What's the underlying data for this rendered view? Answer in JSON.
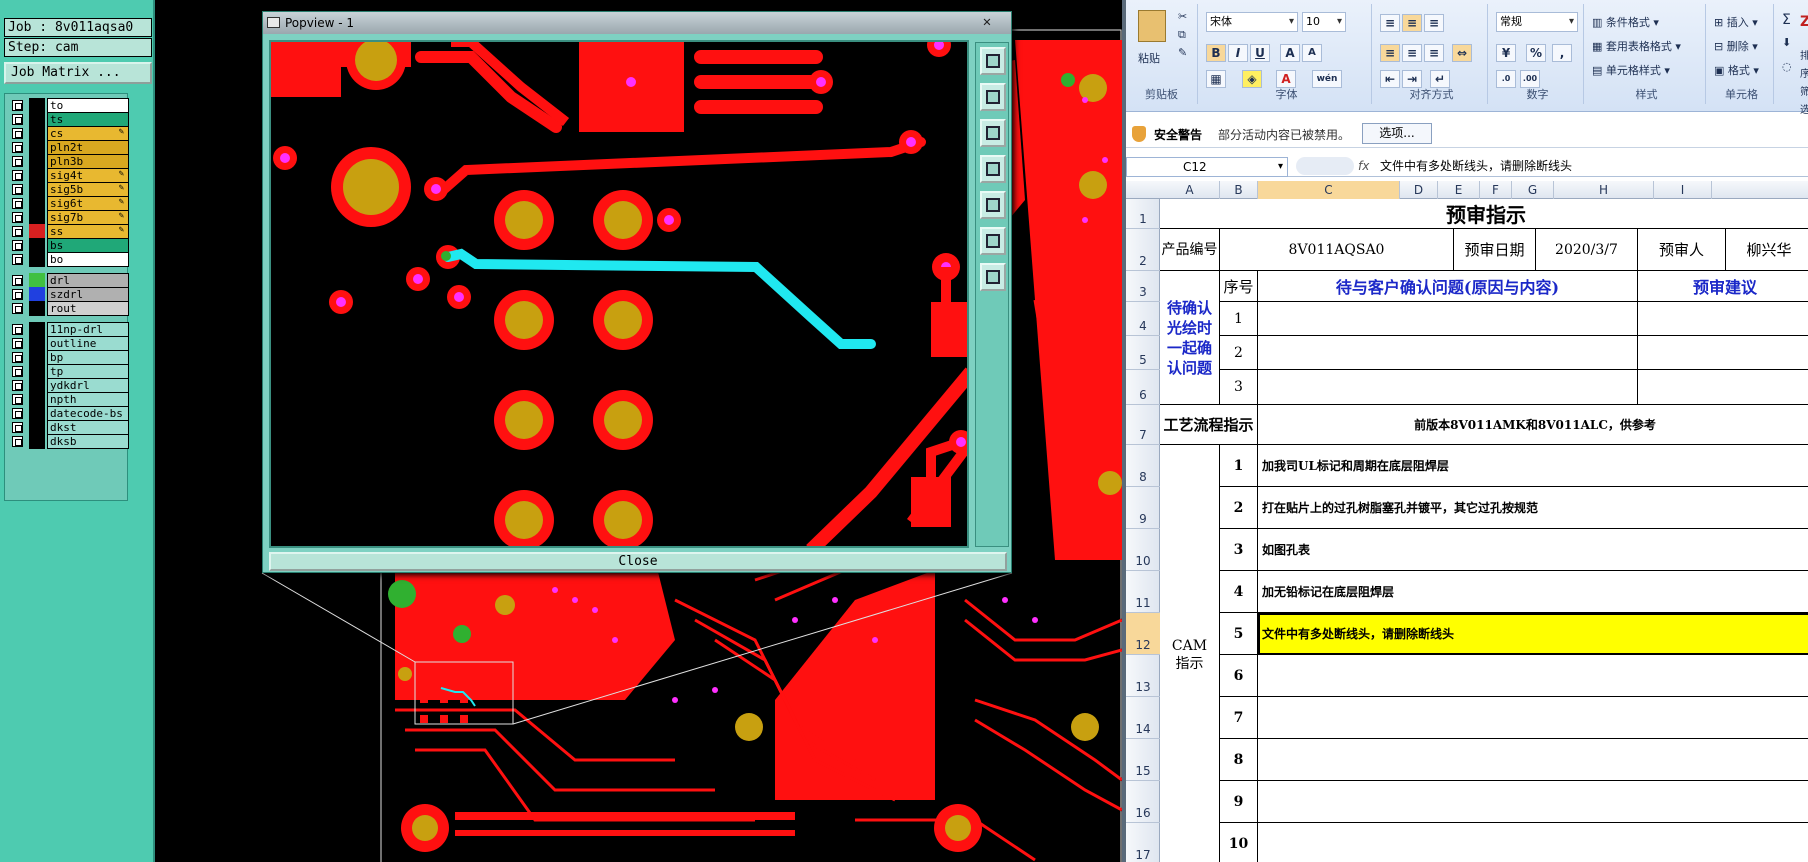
{
  "cam": {
    "job_label": "Job : 8v011aqsa0",
    "step_label": "Step: cam",
    "matrix_button": "Job Matrix ...",
    "layers": [
      {
        "name": "to",
        "color": "#ffffff",
        "swatch": "#000000"
      },
      {
        "name": "ts",
        "color": "#20a878",
        "swatch": "#000000"
      },
      {
        "name": "cs",
        "color": "#e8b830",
        "swatch": "#000000",
        "pen": true
      },
      {
        "name": "pln2t",
        "color": "#d8a820",
        "swatch": "#000000"
      },
      {
        "name": "pln3b",
        "color": "#d8a820",
        "swatch": "#000000"
      },
      {
        "name": "sig4t",
        "color": "#e8b830",
        "swatch": "#000000",
        "pen": true
      },
      {
        "name": "sig5b",
        "color": "#e8b830",
        "swatch": "#000000",
        "pen": true
      },
      {
        "name": "sig6t",
        "color": "#e8b830",
        "swatch": "#000000",
        "pen": true
      },
      {
        "name": "sig7b",
        "color": "#e8b830",
        "swatch": "#000000",
        "pen": true
      },
      {
        "name": "ss",
        "color": "#e8b830",
        "swatch": "#d82020",
        "pen": true,
        "active": true
      },
      {
        "name": "bs",
        "color": "#20a878",
        "swatch": "#000000"
      },
      {
        "name": "bo",
        "color": "#ffffff",
        "swatch": "#000000"
      },
      {
        "name": "drl",
        "color": "#b0b0b0",
        "swatch": "#40c040"
      },
      {
        "name": "szdrl",
        "color": "#b0b0b0",
        "swatch": "#2040e0"
      },
      {
        "name": "rout",
        "color": "#d0d0d0",
        "swatch": "#000000"
      },
      {
        "name": "11np-drl",
        "color": "#9adcd0",
        "swatch": "#000000"
      },
      {
        "name": "outline",
        "color": "#9adcd0",
        "swatch": "#000000"
      },
      {
        "name": "bp",
        "color": "#9adcd0",
        "swatch": "#000000"
      },
      {
        "name": "tp",
        "color": "#9adcd0",
        "swatch": "#000000"
      },
      {
        "name": "ydkdrl",
        "color": "#9adcd0",
        "swatch": "#000000"
      },
      {
        "name": "npth",
        "color": "#9adcd0",
        "swatch": "#000000"
      },
      {
        "name": "datecode-bs",
        "color": "#9adcd0",
        "swatch": "#000000"
      },
      {
        "name": "dkst",
        "color": "#9adcd0",
        "swatch": "#000000"
      },
      {
        "name": "dksb",
        "color": "#9adcd0",
        "swatch": "#000000"
      }
    ],
    "popup": {
      "title": "Popview - 1",
      "close_x": "✕",
      "close_button": "Close"
    },
    "colors": {
      "copper": "#ff1010",
      "pad": "#c8a010",
      "via": "#ff30ff",
      "trace_highlight": "#20e8f0",
      "drill_green": "#30b030"
    }
  },
  "excel": {
    "ribbon": {
      "paste": "粘贴",
      "clipboard": "剪贴板",
      "font_name": "宋体",
      "font_size": "10",
      "font_group": "字体",
      "align_group": "对齐方式",
      "number_format": "常规",
      "number_group": "数字",
      "cond_format": "条件格式",
      "table_format": "套用表格格式",
      "cell_style": "单元格样式",
      "style_group": "样式",
      "insert": "插入",
      "delete": "删除",
      "format": "格式",
      "cells_group": "单元格",
      "sort": "排序",
      "filter": "筛选"
    },
    "security": {
      "title": "安全警告",
      "message": "部分活动内容已被禁用。",
      "options": "选项..."
    },
    "formula": {
      "name_box": "C12",
      "fx": "fx",
      "value": "文件中有多处断线头，请删除断线头"
    },
    "columns": [
      "A",
      "B",
      "C",
      "D",
      "E",
      "F",
      "G",
      "H",
      "I"
    ],
    "rows": [
      "1",
      "2",
      "3",
      "4",
      "5",
      "6",
      "7",
      "8",
      "9",
      "10",
      "11",
      "12",
      "13",
      "14",
      "15",
      "16",
      "17"
    ],
    "sheet": {
      "title": "预审指示",
      "product_label": "产品编号",
      "product_no": "8V011AQSA0",
      "date_label": "预审日期",
      "date": "2020/3/7",
      "reviewer_label": "预审人",
      "reviewer": "柳兴华",
      "pending_label": "待确认光绘时一起确认问题",
      "seq_label": "序号",
      "question_header": "待与客户确认问题(原因与内容)",
      "suggest_header": "预审建议",
      "q_nums": [
        "1",
        "2",
        "3"
      ],
      "process_label": "工艺流程指示",
      "process_text": "前版本8V011AMK和8V011ALC，供参考",
      "cam_label": "CAM指示",
      "cam_items": [
        {
          "n": "1",
          "text": "加我司UL标记和周期在底层阻焊层"
        },
        {
          "n": "2",
          "text": "打在贴片上的过孔树脂塞孔并镀平，其它过孔按规范"
        },
        {
          "n": "3",
          "text": "如图孔表"
        },
        {
          "n": "4",
          "text": "加无铅标记在底层阻焊层"
        },
        {
          "n": "5",
          "text": "文件中有多处断线头，请删除断线头"
        },
        {
          "n": "6",
          "text": ""
        },
        {
          "n": "7",
          "text": ""
        },
        {
          "n": "8",
          "text": ""
        },
        {
          "n": "9",
          "text": ""
        },
        {
          "n": "10",
          "text": ""
        }
      ]
    }
  }
}
